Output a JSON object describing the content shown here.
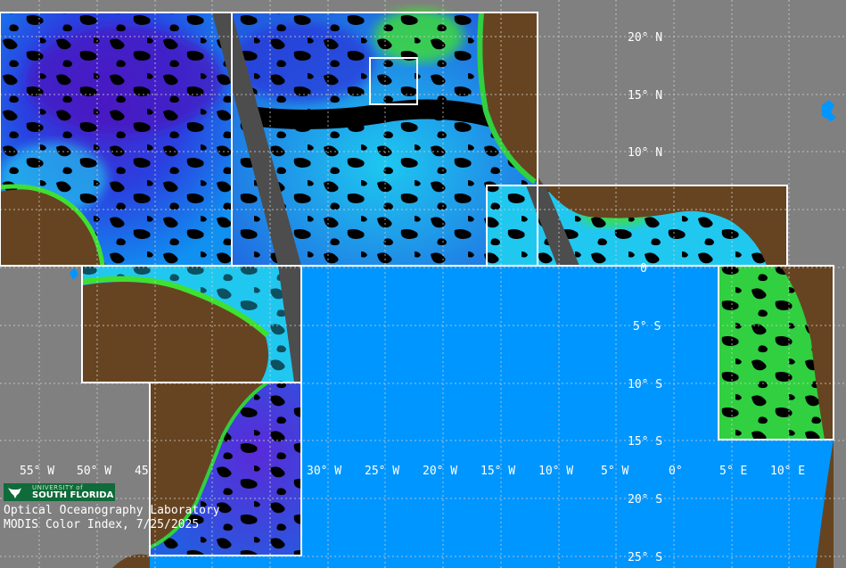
{
  "map": {
    "lat_labels": [
      "20° N",
      "15° N",
      "10° N",
      "0",
      "5° S",
      "10° S",
      "15° S",
      "20° S",
      "25° S"
    ],
    "lon_labels": [
      "55° W",
      "50° W",
      "45",
      "30° W",
      "25° W",
      "20° W",
      "15° W",
      "10° W",
      "5° W",
      "0°",
      "5° E",
      "10° E"
    ],
    "colors": {
      "unsampled": "#808080",
      "land": "#664421",
      "cloud": "#000000",
      "ocean_open": "#0096ff",
      "ocean_cyan": "#20e0f0",
      "ocean_green": "#30d040",
      "ocean_violet": "#3a2ad0",
      "swath_gap": "#4d4d4d",
      "box_outline": "#ffffff"
    }
  },
  "logo": {
    "line1": "UNIVERSITY of",
    "line2": "SOUTH FLORIDA",
    "icon": "bull-icon"
  },
  "caption": {
    "line1": "Optical Oceanography Laboratory",
    "line2": "MODIS Color Index, 7/25/2025"
  }
}
